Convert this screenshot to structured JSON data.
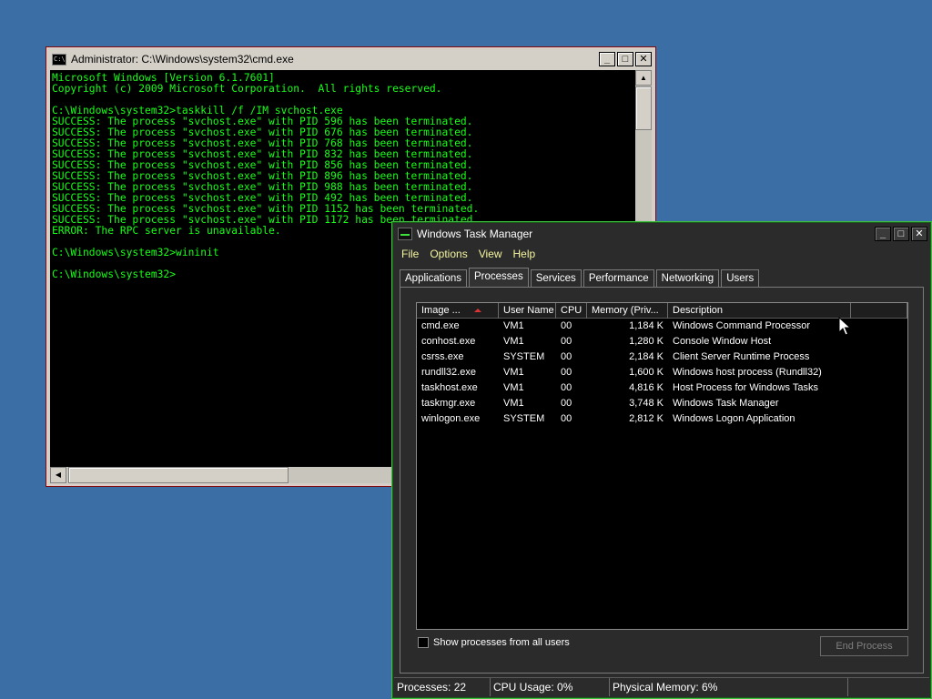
{
  "cmd": {
    "title": "Administrator: C:\\Windows\\system32\\cmd.exe",
    "icon_text": "C:\\",
    "lines": [
      "Microsoft Windows [Version 6.1.7601]",
      "Copyright (c) 2009 Microsoft Corporation.  All rights reserved.",
      "",
      "C:\\Windows\\system32>taskkill /f /IM svchost.exe",
      "SUCCESS: The process \"svchost.exe\" with PID 596 has been terminated.",
      "SUCCESS: The process \"svchost.exe\" with PID 676 has been terminated.",
      "SUCCESS: The process \"svchost.exe\" with PID 768 has been terminated.",
      "SUCCESS: The process \"svchost.exe\" with PID 832 has been terminated.",
      "SUCCESS: The process \"svchost.exe\" with PID 856 has been terminated.",
      "SUCCESS: The process \"svchost.exe\" with PID 896 has been terminated.",
      "SUCCESS: The process \"svchost.exe\" with PID 988 has been terminated.",
      "SUCCESS: The process \"svchost.exe\" with PID 492 has been terminated.",
      "SUCCESS: The process \"svchost.exe\" with PID 1152 has been terminated.",
      "SUCCESS: The process \"svchost.exe\" with PID 1172 has been terminated.",
      "ERROR: The RPC server is unavailable.",
      "",
      "C:\\Windows\\system32>wininit",
      "",
      "C:\\Windows\\system32>"
    ],
    "text_color": "#16ff16"
  },
  "window_controls": {
    "minimize": "_",
    "maximize": "□",
    "close": "✕"
  },
  "scroll": {
    "up": "▲",
    "down": "▼",
    "left": "◀",
    "right": "▶"
  },
  "taskmgr": {
    "title": "Windows Task Manager",
    "menu": [
      "File",
      "Options",
      "View",
      "Help"
    ],
    "tabs": [
      "Applications",
      "Processes",
      "Services",
      "Performance",
      "Networking",
      "Users"
    ],
    "active_tab": "Processes",
    "columns": [
      "Image ...",
      "User Name",
      "CPU",
      "Memory (Priv...",
      "Description",
      ""
    ],
    "rows": [
      [
        "cmd.exe",
        "VM1",
        "00",
        "1,184 K",
        "Windows Command Processor"
      ],
      [
        "conhost.exe",
        "VM1",
        "00",
        "1,280 K",
        "Console Window Host"
      ],
      [
        "csrss.exe",
        "SYSTEM",
        "00",
        "2,184 K",
        "Client Server Runtime Process"
      ],
      [
        "rundll32.exe",
        "VM1",
        "00",
        "1,600 K",
        "Windows host process (Rundll32)"
      ],
      [
        "taskhost.exe",
        "VM1",
        "00",
        "4,816 K",
        "Host Process for Windows Tasks"
      ],
      [
        "taskmgr.exe",
        "VM1",
        "00",
        "3,748 K",
        "Windows Task Manager"
      ],
      [
        "winlogon.exe",
        "SYSTEM",
        "00",
        "2,812 K",
        "Windows Logon Application"
      ]
    ],
    "show_all_label": "Show processes from all users",
    "end_process_label": "End Process",
    "status": {
      "processes": "Processes: 22",
      "cpu": "CPU Usage: 0%",
      "memory": "Physical Memory: 6%"
    },
    "accent": "#3fbf3f",
    "menu_color": "#f5f5a0"
  },
  "desktop_color": "#3a6ea5"
}
